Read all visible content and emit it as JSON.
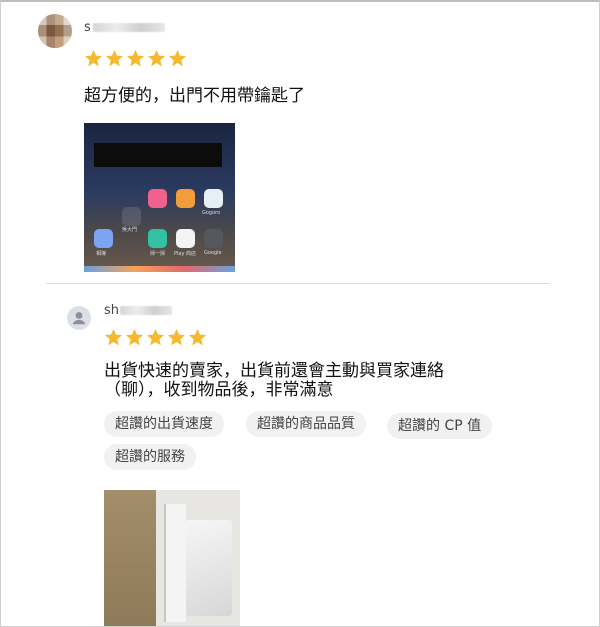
{
  "review1": {
    "username": "s",
    "rating": 5,
    "text": "超方便的，出門不用帶鑰匙了",
    "photo_labels": [
      "吳大門",
      "相簿",
      "掃一掃",
      "Play 商店",
      "Google",
      "Gogoro"
    ]
  },
  "review2": {
    "username": "sh",
    "rating": 5,
    "text_line1": "出貨快速的賣家，出貨前還會主動與買家連絡",
    "text_line2": "（聊），收到物品後，非常滿意",
    "chips": [
      "超讚的出貨速度",
      "超讚的商品品質",
      "超讚的 CP 值",
      "超讚的服務"
    ]
  },
  "colors": {
    "star": "#f5b82e",
    "chip_bg": "#f1f1f1"
  },
  "icons": [
    "star-icon",
    "user-icon"
  ]
}
